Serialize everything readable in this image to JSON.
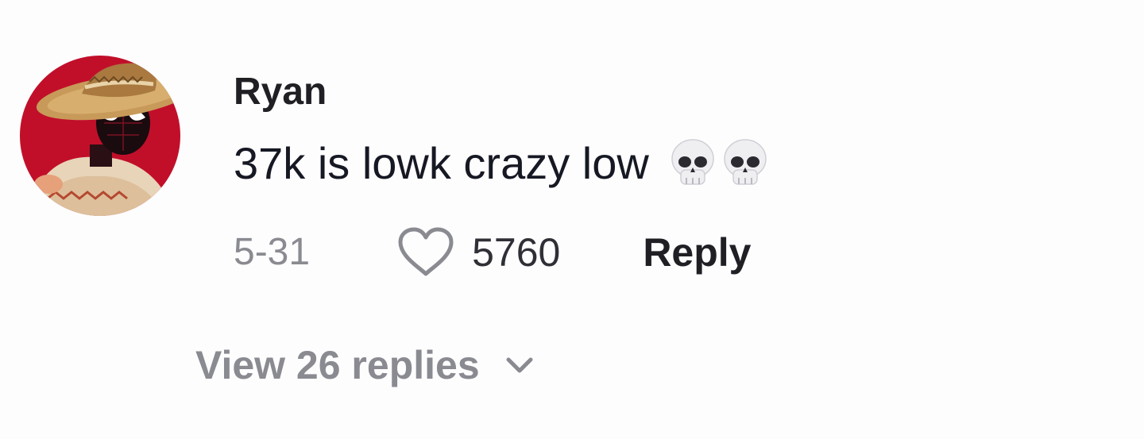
{
  "comment": {
    "username": "Ryan",
    "text": "37k is lowk crazy low",
    "emojis": [
      "skull-emoji",
      "skull-emoji"
    ],
    "date": "5-31",
    "like_count": "5760",
    "reply_label": "Reply",
    "view_replies_label": "View 26 replies"
  },
  "icons": {
    "like": "heart-outline-icon",
    "expand": "chevron-down-icon"
  },
  "colors": {
    "avatar_background": "#c10f2a",
    "secondary_text": "#8a8b91",
    "primary_text": "#161823"
  }
}
